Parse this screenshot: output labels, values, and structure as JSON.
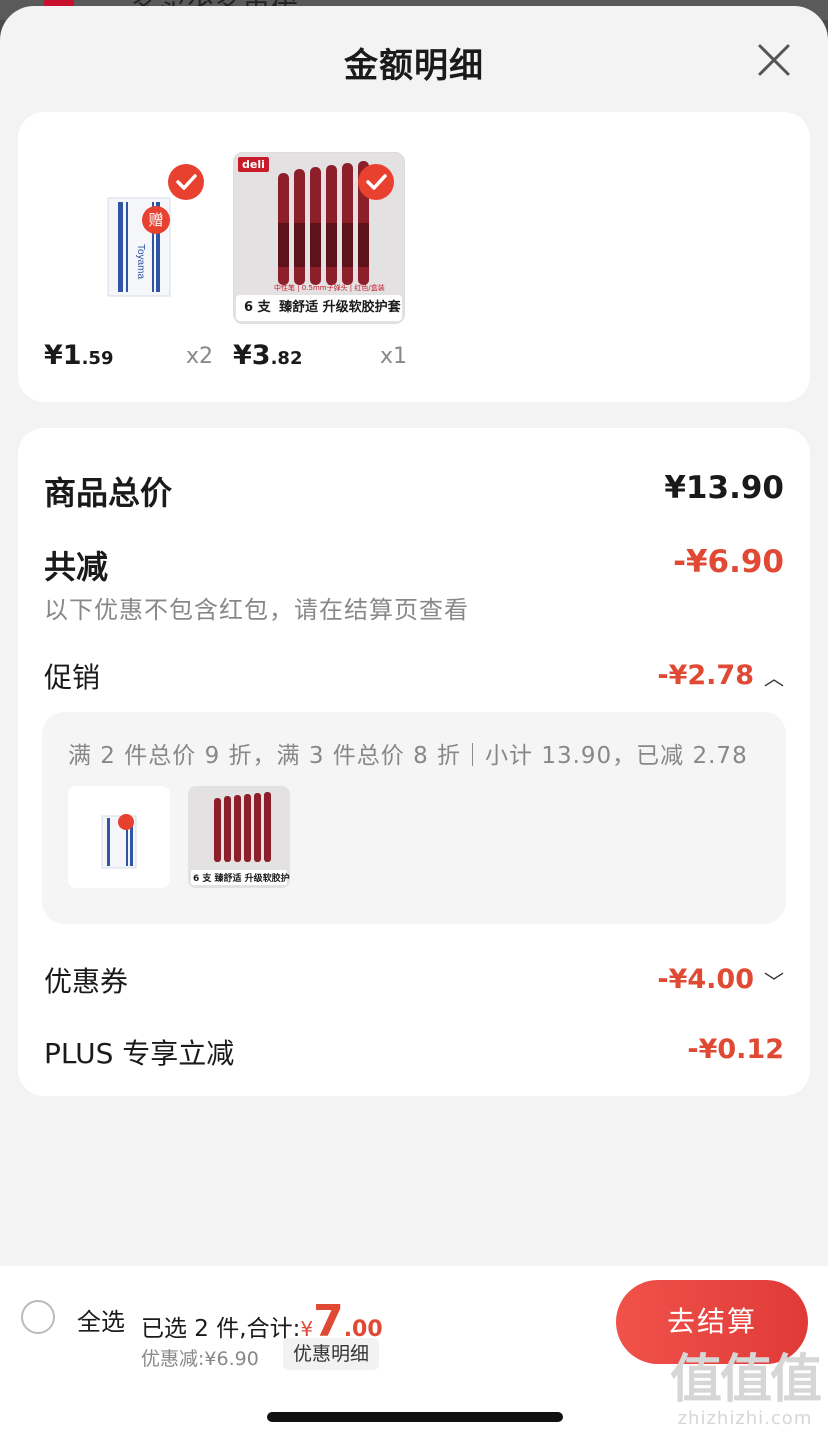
{
  "sheet": {
    "title": "金额明细"
  },
  "items": [
    {
      "price_int": "¥1",
      "price_dec": ".59",
      "qty": "x2",
      "gift_badge": "赠",
      "image_icon": "eraser-package-image"
    },
    {
      "price_int": "¥3",
      "price_dec": ".82",
      "qty": "x1",
      "image_icon": "gel-pen-pack-image",
      "pack_brand": "deli",
      "pack_count": "6 支",
      "pack_slogan": "臻舒适 升级软胶护套",
      "pack_info": "中性笔 | 0.5mm子弹头 | 红色/盒装"
    }
  ],
  "summary": {
    "goods_total_label": "商品总价",
    "goods_total_value": "¥13.90",
    "total_reduce_label": "共减",
    "total_reduce_value": "-¥6.90",
    "note": "以下优惠不包含红包，请在结算页查看",
    "promo_label": "促销",
    "promo_value": "-¥2.78",
    "promo_detail": "满 2 件总价 9 折，满 3 件总价 8 折｜小计 13.90，已减 2.78",
    "coupon_label": "优惠券",
    "coupon_value": "-¥4.00",
    "plus_label": "PLUS 专享立减",
    "plus_value": "-¥0.12"
  },
  "bottom": {
    "select_all": "全选",
    "selected_text": "已选 2 件,合计:",
    "total_yen": "¥",
    "total_int": "7",
    "total_dec": ".00",
    "discount": "优惠减:¥6.90",
    "detail_button": "优惠明细",
    "checkout_button": "去结算"
  },
  "background": {
    "text": "多买省多更优"
  },
  "watermark": {
    "logo": "值值值",
    "site": "zhizhizhi.com"
  },
  "colors": {
    "accent_red": "#e04a34",
    "check_red": "#e8412f",
    "pen_red": "#8c1f2a"
  }
}
